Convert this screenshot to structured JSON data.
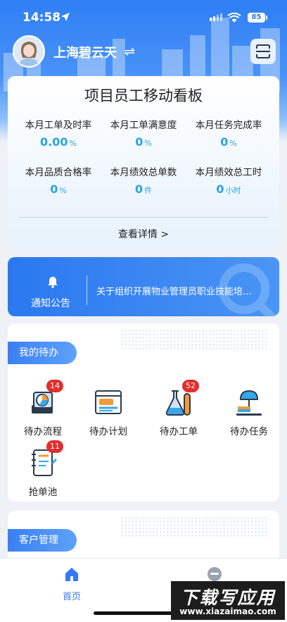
{
  "status_bar": {
    "time": "14:58",
    "battery": "85"
  },
  "header": {
    "org_name": "上海碧云天",
    "switch_symbol": "⇌"
  },
  "board": {
    "title": "项目员工移动看板",
    "metrics": [
      {
        "label": "本月工单及时率",
        "value": "0.00",
        "unit": "%"
      },
      {
        "label": "本月工单满意度",
        "value": "0",
        "unit": "%"
      },
      {
        "label": "本月任务完成率",
        "value": "0",
        "unit": "%"
      },
      {
        "label": "本月品质合格率",
        "value": "0",
        "unit": "%"
      },
      {
        "label": "本月绩效总单数",
        "value": "0",
        "unit": "件"
      },
      {
        "label": "本月绩效总工时",
        "value": "0",
        "unit": "小时"
      }
    ],
    "detail_link": "查看详情 >"
  },
  "notice": {
    "label": "通知公告",
    "text": "关于组织开展物业管理员职业技能培…"
  },
  "todo": {
    "title": "我的待办",
    "items": [
      {
        "label": "待办流程",
        "badge": "14",
        "icon": "process-chart-icon"
      },
      {
        "label": "待办计划",
        "badge": "",
        "icon": "plan-window-icon"
      },
      {
        "label": "待办工单",
        "badge": "52",
        "icon": "flask-icon"
      },
      {
        "label": "待办任务",
        "badge": "",
        "icon": "desk-lamp-icon"
      },
      {
        "label": "抢单池",
        "badge": "11",
        "icon": "notebook-icon"
      }
    ]
  },
  "customer": {
    "title": "客户管理"
  },
  "tabbar": {
    "tabs": [
      {
        "label": "首页",
        "icon": "home-icon",
        "active": true
      },
      {
        "label": "",
        "icon": "profile-icon",
        "active": false
      }
    ],
    "active_color": "#3478f6"
  },
  "watermark": {
    "main": "下载写应用",
    "sub": "www.xiazaimao.com"
  },
  "colors": {
    "primary": "#2f7ef5",
    "metric": "#2aa3e6",
    "badge": "#e42d2d"
  }
}
